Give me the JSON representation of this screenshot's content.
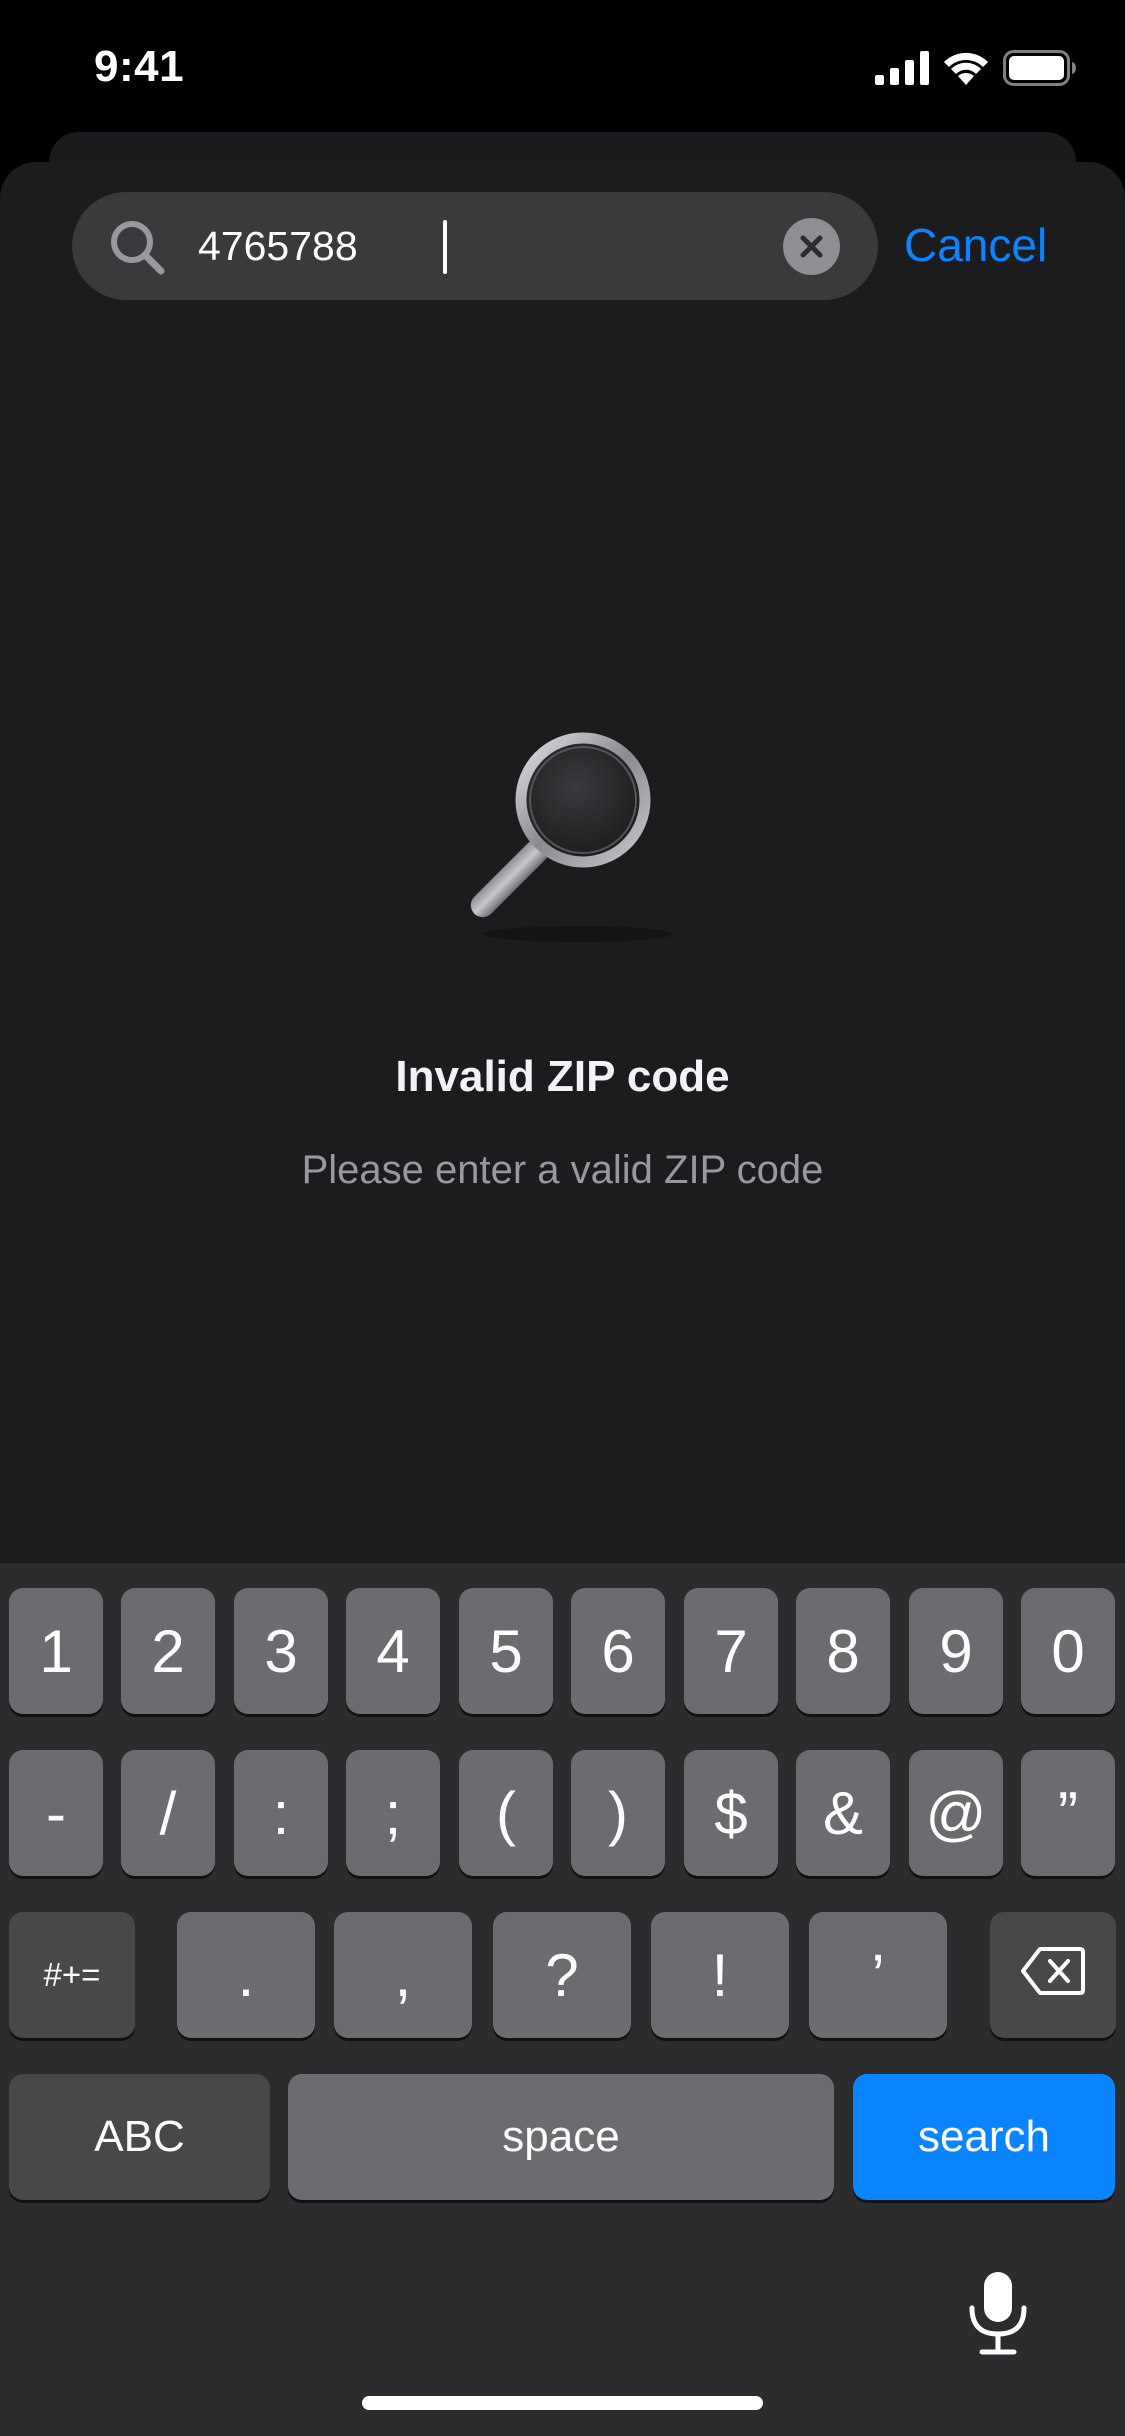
{
  "status_bar": {
    "time": "9:41"
  },
  "search": {
    "value": "4765788",
    "cancel_label": "Cancel"
  },
  "empty_state": {
    "title": "Invalid ZIP code",
    "subtitle": "Please enter a valid ZIP code"
  },
  "keyboard": {
    "row1": [
      "1",
      "2",
      "3",
      "4",
      "5",
      "6",
      "7",
      "8",
      "9",
      "0"
    ],
    "row2": [
      "-",
      "/",
      ":",
      ";",
      "(",
      ")",
      "$",
      "&",
      "@",
      "”"
    ],
    "row3": {
      "toggle": "#+=",
      "keys": [
        ".",
        ",",
        "?",
        "!",
        "’"
      ]
    },
    "row4": {
      "abc": "ABC",
      "space": "space",
      "search": "search"
    }
  },
  "colors": {
    "accent": "#0a84ff",
    "sheet": "#1c1c1e",
    "field": "#3a3a3c"
  },
  "icons": [
    "signal-icon",
    "wifi-icon",
    "battery-icon",
    "search-icon",
    "clear-icon",
    "magnifying-glass-icon",
    "delete-icon",
    "microphone-icon"
  ]
}
